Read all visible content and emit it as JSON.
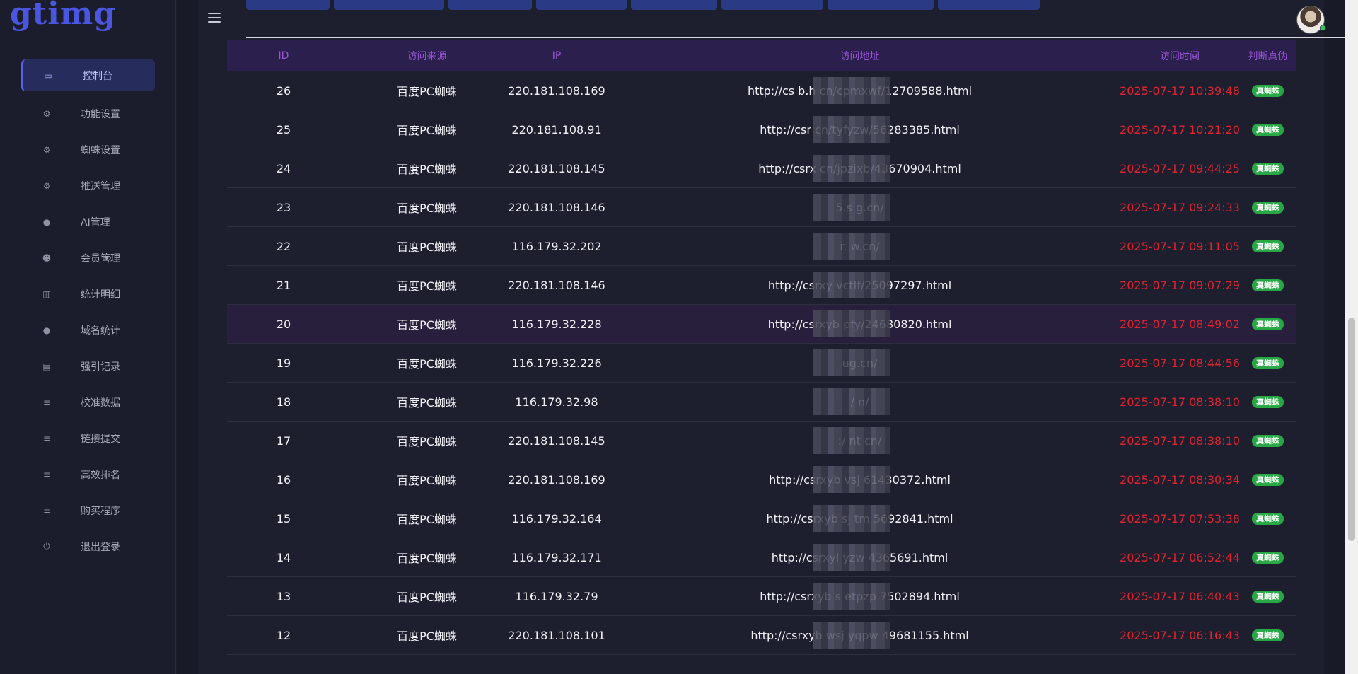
{
  "app": {
    "logo": "gtimg"
  },
  "sidebar": {
    "items": [
      {
        "label": "控制台",
        "icon": "laptop-icon",
        "glyph": "▭",
        "active": true
      },
      {
        "label": "功能设置",
        "icon": "gears-icon",
        "glyph": "⚙"
      },
      {
        "label": "蜘蛛设置",
        "icon": "gears-icon",
        "glyph": "⚙"
      },
      {
        "label": "推送管理",
        "icon": "gears-icon",
        "glyph": "⚙"
      },
      {
        "label": "AI管理",
        "icon": "globe-icon",
        "glyph": "●"
      },
      {
        "label": "会员管理",
        "icon": "users-icon",
        "glyph": "☻",
        "suffix": "▾›"
      },
      {
        "label": "统计明细",
        "icon": "bar-chart-icon",
        "glyph": "▥"
      },
      {
        "label": "域名统计",
        "icon": "globe-icon",
        "glyph": "●"
      },
      {
        "label": "强引记录",
        "icon": "copy-icon",
        "glyph": "▤"
      },
      {
        "label": "校准数据",
        "icon": "list-icon",
        "glyph": "≡"
      },
      {
        "label": "链接提交",
        "icon": "list-icon",
        "glyph": "≡"
      },
      {
        "label": "高效排名",
        "icon": "list-icon",
        "glyph": "≡"
      },
      {
        "label": "购买程序",
        "icon": "list-icon",
        "glyph": "≡"
      },
      {
        "label": "退出登录",
        "icon": "power-icon",
        "glyph": "⏻"
      }
    ]
  },
  "table": {
    "headers": {
      "id": "ID",
      "source": "访问来源",
      "ip": "IP",
      "url": "访问地址",
      "time": "访问时间",
      "verdict": "判断真伪"
    },
    "rows": [
      {
        "id": "26",
        "source": "百度PC蜘蛛",
        "ip": "220.181.108.169",
        "url": "http://cs b.h cn/cpmxwf/12709588.html",
        "time": "2025-07-17 10:39:48",
        "verdict": "真蜘蛛"
      },
      {
        "id": "25",
        "source": "百度PC蜘蛛",
        "ip": "220.181.108.91",
        "url": "http://csr cn/tyfyzw/56283385.html",
        "time": "2025-07-17 10:21:20",
        "verdict": "真蜘蛛"
      },
      {
        "id": "24",
        "source": "百度PC蜘蛛",
        "ip": "220.181.108.145",
        "url": "http://csrx cn/jpzixb/43670904.html",
        "time": "2025-07-17 09:44:25",
        "verdict": "真蜘蛛"
      },
      {
        "id": "23",
        "source": "百度PC蜘蛛",
        "ip": "220.181.108.146",
        "url": "5.s g.cn/",
        "time": "2025-07-17 09:24:33",
        "verdict": "真蜘蛛"
      },
      {
        "id": "22",
        "source": "百度PC蜘蛛",
        "ip": "116.179.32.202",
        "url": "r. w.cn/",
        "time": "2025-07-17 09:11:05",
        "verdict": "真蜘蛛"
      },
      {
        "id": "21",
        "source": "百度PC蜘蛛",
        "ip": "220.181.108.146",
        "url": "http://csrxy vctlf/25097297.html",
        "time": "2025-07-17 09:07:29",
        "verdict": "真蜘蛛"
      },
      {
        "id": "20",
        "source": "百度PC蜘蛛",
        "ip": "116.179.32.228",
        "url": "http://csrxyb pfy/24680820.html",
        "time": "2025-07-17 08:49:02",
        "verdict": "真蜘蛛",
        "highlight": true
      },
      {
        "id": "19",
        "source": "百度PC蜘蛛",
        "ip": "116.179.32.226",
        "url": "ug.cn/",
        "time": "2025-07-17 08:44:56",
        "verdict": "真蜘蛛"
      },
      {
        "id": "18",
        "source": "百度PC蜘蛛",
        "ip": "116.179.32.98",
        "url": "/ n/",
        "time": "2025-07-17 08:38:10",
        "verdict": "真蜘蛛"
      },
      {
        "id": "17",
        "source": "百度PC蜘蛛",
        "ip": "220.181.108.145",
        "url": ":/ nt cn/",
        "time": "2025-07-17 08:38:10",
        "verdict": "真蜘蛛"
      },
      {
        "id": "16",
        "source": "百度PC蜘蛛",
        "ip": "220.181.108.169",
        "url": "http://csrxyb vsj 61430372.html",
        "time": "2025-07-17 08:30:34",
        "verdict": "真蜘蛛"
      },
      {
        "id": "15",
        "source": "百度PC蜘蛛",
        "ip": "116.179.32.164",
        "url": "http://csrxyb sj tm 5692841.html",
        "time": "2025-07-17 07:53:38",
        "verdict": "真蜘蛛"
      },
      {
        "id": "14",
        "source": "百度PC蜘蛛",
        "ip": "116.179.32.171",
        "url": "http://csrxyl yzw 4365691.html",
        "time": "2025-07-17 06:52:44",
        "verdict": "真蜘蛛"
      },
      {
        "id": "13",
        "source": "百度PC蜘蛛",
        "ip": "116.179.32.79",
        "url": "http://csrxyb s etpzp 7502894.html",
        "time": "2025-07-17 06:40:43",
        "verdict": "真蜘蛛"
      },
      {
        "id": "12",
        "source": "百度PC蜘蛛",
        "ip": "220.181.108.101",
        "url": "http://csrxyb wsj yqpw 49681155.html",
        "time": "2025-07-17 06:16:43",
        "verdict": "真蜘蛛"
      }
    ]
  }
}
